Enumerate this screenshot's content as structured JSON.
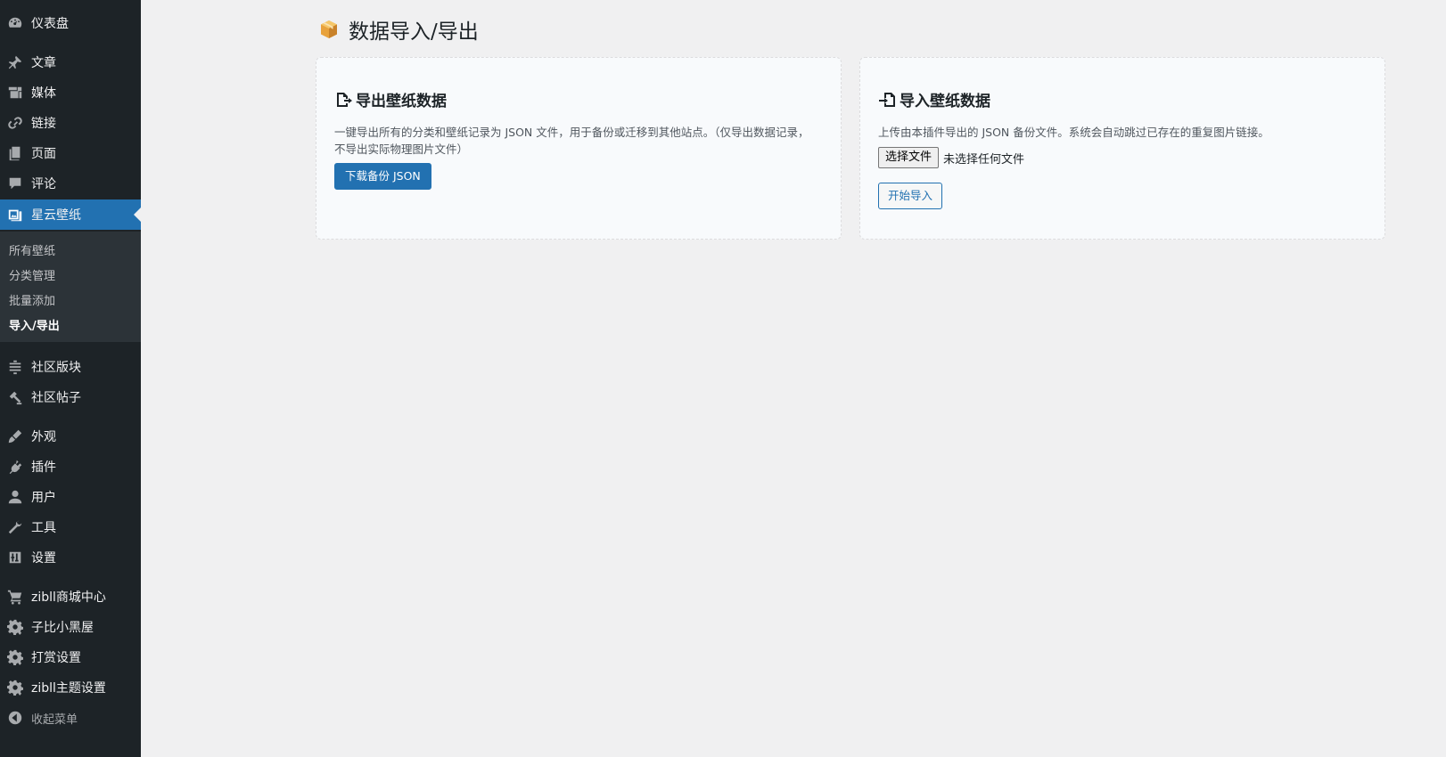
{
  "sidebar": {
    "items": [
      {
        "label": "仪表盘",
        "icon": "dashboard-icon"
      },
      {
        "label": "文章",
        "icon": "pin-icon"
      },
      {
        "label": "媒体",
        "icon": "media-icon"
      },
      {
        "label": "链接",
        "icon": "link-icon"
      },
      {
        "label": "页面",
        "icon": "page-icon"
      },
      {
        "label": "评论",
        "icon": "comment-icon"
      },
      {
        "label": "星云壁纸",
        "icon": "gallery-icon",
        "active": true
      },
      {
        "label": "社区版块",
        "icon": "layers-icon"
      },
      {
        "label": "社区帖子",
        "icon": "hammer-icon"
      },
      {
        "label": "外观",
        "icon": "brush-icon"
      },
      {
        "label": "插件",
        "icon": "plugin-icon"
      },
      {
        "label": "用户",
        "icon": "user-icon"
      },
      {
        "label": "工具",
        "icon": "wrench-icon"
      },
      {
        "label": "设置",
        "icon": "settings-icon"
      },
      {
        "label": "zibll商城中心",
        "icon": "cart-icon"
      },
      {
        "label": "子比小黑屋",
        "icon": "gear-icon"
      },
      {
        "label": "打赏设置",
        "icon": "gear-icon"
      },
      {
        "label": "zibll主题设置",
        "icon": "gear-icon"
      },
      {
        "label": "收起菜单",
        "icon": "collapse-icon"
      }
    ],
    "submenu": [
      {
        "label": "所有壁纸"
      },
      {
        "label": "分类管理"
      },
      {
        "label": "批量添加"
      },
      {
        "label": "导入/导出",
        "current": true
      }
    ]
  },
  "page": {
    "title": "数据导入/导出"
  },
  "export_card": {
    "title": "导出壁纸数据",
    "description": "一键导出所有的分类和壁纸记录为 JSON 文件，用于备份或迁移到其他站点。（仅导出数据记录，不导出实际物理图片文件）",
    "button_label": "下载备份 JSON"
  },
  "import_card": {
    "title": "导入壁纸数据",
    "description": "上传由本插件导出的 JSON 备份文件。系统会自动跳过已存在的重复图片链接。",
    "file_button_label": "选择文件",
    "file_status": "未选择任何文件",
    "button_label": "开始导入"
  },
  "colors": {
    "sidebar_bg": "#1d2327",
    "accent": "#2271b1",
    "page_bg": "#f0f0f1"
  }
}
